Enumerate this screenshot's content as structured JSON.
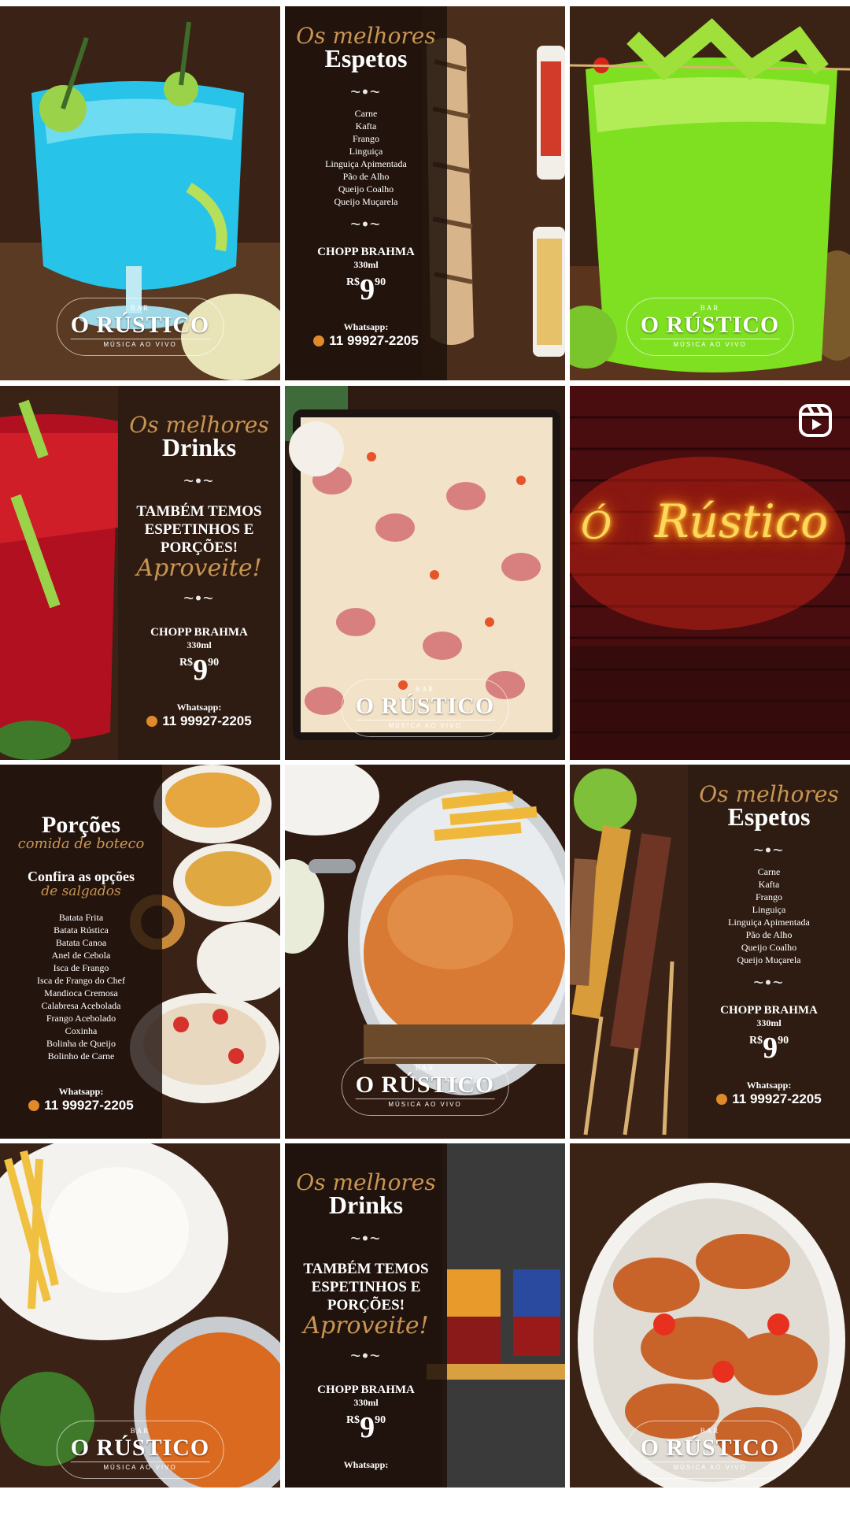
{
  "tiles": {
    "espetos_1": {
      "script_title": "Os melhores",
      "heading": "Espetos",
      "items": [
        "Carne",
        "Kafta",
        "Frango",
        "Linguiça",
        "Linguiça Apimentada",
        "Pão de Alho",
        "Queijo Coalho",
        "Queijo Muçarela"
      ],
      "chopp": "CHOPP BRAHMA",
      "volume": "330ml",
      "price_currency": "R$",
      "price_int": "9",
      "price_dec": "90",
      "whatsapp_label": "Whatsapp:",
      "whatsapp_number": "11 99927-2205"
    },
    "drinks_1": {
      "script_title": "Os melhores",
      "heading": "Drinks",
      "promo_line1": "TAMBÉM TEMOS",
      "promo_line2": "ESPETINHOS E",
      "promo_line3": "PORÇÕES!",
      "promo_script": "Aproveite!",
      "chopp": "CHOPP BRAHMA",
      "volume": "330ml",
      "price_currency": "R$",
      "price_int": "9",
      "price_dec": "90",
      "whatsapp_label": "Whatsapp:",
      "whatsapp_number": "11 99927-2205"
    },
    "neon": {
      "text_o": "Ó",
      "text_rustico": "Rústico"
    },
    "porcoes": {
      "heading": "Porções",
      "script_sub": "comida de boteco",
      "confira": "Confira as opções",
      "confira_script": "de salgados",
      "items": [
        "Batata Frita",
        "Batata Rústica",
        "Batata Canoa",
        "Anel de Cebola",
        "Isca de Frango",
        "Isca de Frango do Chef",
        "Mandioca Cremosa",
        "Calabresa Acebolada",
        "Frango Acebolado",
        "Coxinha",
        "Bolinha de Queijo",
        "Bolinho de Carne"
      ],
      "whatsapp_label": "Whatsapp:",
      "whatsapp_number": "11 99927-2205"
    },
    "espetos_2": {
      "script_title": "Os melhores",
      "heading": "Espetos",
      "items": [
        "Carne",
        "Kafta",
        "Frango",
        "Linguiça",
        "Linguiça Apimentada",
        "Pão de Alho",
        "Queijo Coalho",
        "Queijo Muçarela"
      ],
      "chopp": "CHOPP BRAHMA",
      "volume": "330ml",
      "price_currency": "R$",
      "price_int": "9",
      "price_dec": "90",
      "whatsapp_label": "Whatsapp:",
      "whatsapp_number": "11 99927-2205"
    },
    "drinks_2": {
      "script_title": "Os melhores",
      "heading": "Drinks",
      "promo_line1": "TAMBÉM TEMOS",
      "promo_line2": "ESPETINHOS E",
      "promo_line3": "PORÇÕES!",
      "promo_script": "Aproveite!",
      "chopp": "CHOPP BRAHMA",
      "volume": "330ml",
      "price_currency": "R$",
      "price_int": "9",
      "price_dec": "90",
      "whatsapp_label": "Whatsapp:"
    }
  },
  "logo": {
    "bar": "BAR",
    "name": "O RÚSTICO",
    "sub": "MÚSICA AO VIVO"
  },
  "icons": {
    "reel": "reels-icon",
    "whatsapp": "whatsapp-icon"
  },
  "colors": {
    "accent_gold": "#c99552",
    "panel": "#1e120c",
    "neon": "#ffd75a",
    "whatsapp_icon": "#e08a2a"
  }
}
